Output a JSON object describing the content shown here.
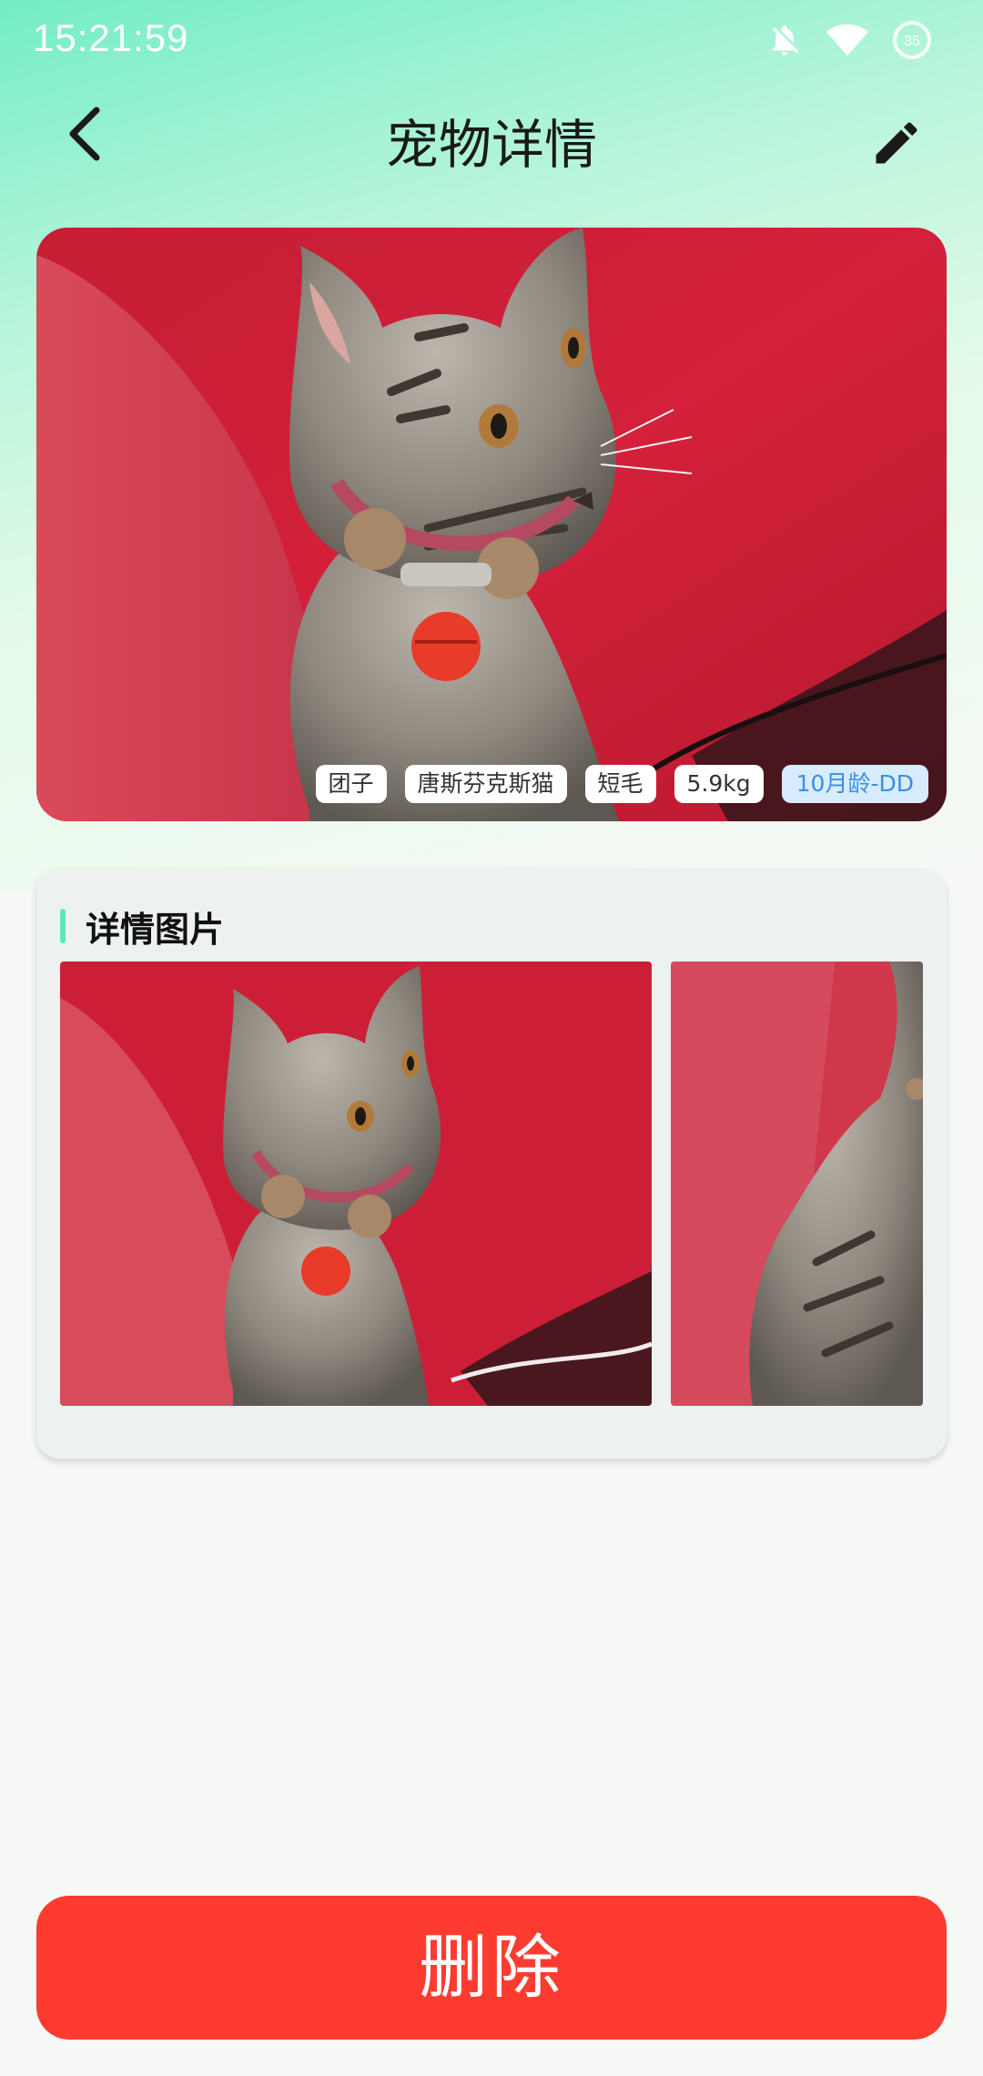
{
  "status_bar": {
    "time": "15:21:59",
    "battery": "35",
    "icons": [
      "bell-off-icon",
      "wifi-icon",
      "battery-icon"
    ]
  },
  "header": {
    "title": "宠物详情",
    "back_icon": "chevron-left-icon",
    "edit_icon": "pencil-icon"
  },
  "pet": {
    "tags": [
      {
        "label": "团子"
      },
      {
        "label": "唐斯芬克斯猫"
      },
      {
        "label": "短毛"
      },
      {
        "label": "5.9kg"
      },
      {
        "label": "10月龄-DD"
      }
    ]
  },
  "detail": {
    "section_title": "详情图片",
    "image_count": 2
  },
  "actions": {
    "delete_label": "删除"
  },
  "colors": {
    "accent_green": "#5ee7bd",
    "delete_red": "#fe3b30",
    "age_tag_text": "#3b8fe2",
    "age_tag_bg": "#d7ecff"
  }
}
